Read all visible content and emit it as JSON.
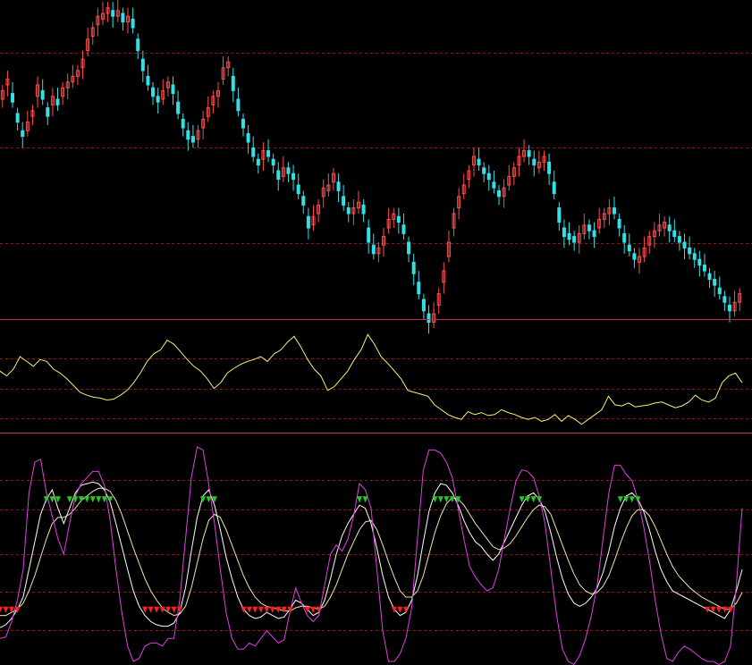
{
  "colors": {
    "background": "#000000",
    "grid": "#8b1a1a",
    "separator": "#c0304a",
    "up_candle": "#ff4d4d",
    "down_candle": "#33e0e6",
    "osc_line": "#f5f07a",
    "kdj_k": "#ffffff",
    "kdj_d": "#f0e6a8",
    "kdj_j": "#e040e0",
    "buy_marker": "#22cc22",
    "sell_marker": "#ff2020"
  },
  "chart_data": [
    {
      "type": "candlestick",
      "name": "price",
      "grid": true,
      "ylim": [
        0,
        100
      ],
      "close": [
        73,
        77,
        69,
        62,
        57,
        62,
        66,
        75,
        70,
        64,
        71,
        68,
        74,
        76,
        78,
        80,
        84,
        91,
        95,
        99,
        100,
        102,
        99,
        101,
        97,
        99,
        95,
        87,
        80,
        75,
        71,
        69,
        73,
        76,
        72,
        65,
        60,
        56,
        55,
        59,
        63,
        67,
        71,
        73,
        81,
        83,
        73,
        66,
        60,
        55,
        50,
        47,
        52,
        50,
        47,
        42,
        46,
        44,
        42,
        37,
        33,
        25,
        29,
        33,
        39,
        40,
        44,
        38,
        33,
        30,
        32,
        34,
        30,
        20,
        16,
        18,
        22,
        28,
        30,
        27,
        23,
        16,
        9,
        2,
        -4,
        -8,
        -5,
        2,
        10,
        20,
        30,
        36,
        40,
        45,
        50,
        47,
        44,
        42,
        39,
        36,
        39,
        43,
        46,
        50,
        52,
        50,
        47,
        48,
        50,
        44,
        37,
        27,
        22,
        21,
        20,
        23,
        26,
        24,
        22,
        28,
        30,
        32,
        30,
        25,
        20,
        17,
        14,
        15,
        18,
        22,
        24,
        26,
        27,
        24,
        22,
        20,
        18,
        16,
        14,
        12,
        10,
        7,
        5,
        2,
        -1,
        -4,
        -1,
        2
      ],
      "open_offsets": [
        -3,
        -2,
        3,
        3,
        2,
        -3,
        -2,
        -4,
        3,
        3,
        -3,
        2,
        -3,
        -2,
        -2,
        -2,
        -3,
        -4,
        -3,
        -3,
        -2,
        -2,
        2,
        -2,
        3,
        -2,
        3,
        4,
        4,
        3,
        3,
        2,
        -3,
        -2,
        3,
        4,
        3,
        3,
        2,
        -3,
        -3,
        -3,
        -3,
        -2,
        -4,
        -2,
        5,
        4,
        3,
        3,
        3,
        2,
        -3,
        2,
        2,
        3,
        -3,
        2,
        2,
        3,
        3,
        4,
        -3,
        -3,
        -3,
        -2,
        -3,
        3,
        3,
        2,
        -2,
        -2,
        3,
        5,
        3,
        -2,
        -3,
        -3,
        -2,
        2,
        3,
        4,
        4,
        4,
        4,
        3,
        -3,
        -4,
        -4,
        -5,
        -5,
        -4,
        -3,
        -3,
        -3,
        2,
        2,
        2,
        2,
        2,
        -3,
        -3,
        -3,
        -3,
        -2,
        2,
        2,
        -2,
        -2,
        4,
        4,
        5,
        3,
        2,
        2,
        -3,
        -3,
        2,
        2,
        -3,
        -2,
        -2,
        2,
        3,
        3,
        2,
        2,
        -2,
        -3,
        -3,
        -2,
        -2,
        -2,
        2,
        2,
        2,
        2,
        2,
        2,
        2,
        2,
        2,
        2,
        2,
        2,
        2,
        -3,
        -3
      ]
    },
    {
      "type": "line",
      "name": "oscillator",
      "grid": true,
      "ylim": [
        0,
        100
      ],
      "values": [
        60,
        55,
        62,
        75,
        70,
        65,
        72,
        70,
        62,
        58,
        52,
        45,
        38,
        35,
        33,
        32,
        30,
        31,
        35,
        40,
        48,
        58,
        70,
        78,
        82,
        92,
        88,
        80,
        72,
        65,
        60,
        52,
        42,
        48,
        58,
        63,
        67,
        70,
        72,
        75,
        70,
        78,
        82,
        90,
        96,
        85,
        72,
        62,
        55,
        40,
        44,
        52,
        60,
        72,
        82,
        98,
        88,
        75,
        68,
        60,
        52,
        40,
        38,
        36,
        34,
        25,
        20,
        15,
        12,
        10,
        18,
        15,
        17,
        14,
        15,
        20,
        17,
        15,
        12,
        10,
        12,
        8,
        10,
        15,
        8,
        14,
        10,
        5,
        10,
        15,
        20,
        34,
        25,
        24,
        27,
        23,
        24,
        25,
        27,
        28,
        25,
        22,
        24,
        28,
        35,
        30,
        28,
        32,
        48,
        55,
        58,
        48
      ]
    },
    {
      "type": "line",
      "name": "kdj",
      "grid": true,
      "ylim": [
        -20,
        120
      ],
      "series": [
        {
          "id": "k",
          "values": [
            2,
            4,
            8,
            14,
            22,
            40,
            58,
            76,
            86,
            92,
            80,
            70,
            80,
            90,
            95,
            96,
            97,
            96,
            92,
            84,
            70,
            55,
            40,
            26,
            16,
            10,
            6,
            4,
            3,
            3,
            5,
            12,
            28,
            52,
            74,
            88,
            92,
            82,
            66,
            48,
            34,
            22,
            14,
            10,
            8,
            9,
            12,
            10,
            8,
            9,
            14,
            20,
            18,
            14,
            10,
            12,
            20,
            34,
            50,
            62,
            70,
            76,
            82,
            80,
            70,
            54,
            36,
            22,
            14,
            10,
            12,
            20,
            36,
            58,
            78,
            90,
            96,
            95,
            90,
            82,
            72,
            64,
            58,
            55,
            50,
            46,
            50,
            58,
            66,
            74,
            82,
            88,
            90,
            86,
            78,
            64,
            48,
            34,
            24,
            18,
            16,
            18,
            22,
            28,
            38,
            52,
            68,
            80,
            88,
            90,
            86,
            78,
            66,
            52,
            40,
            32,
            26,
            24,
            22,
            20,
            18,
            16,
            14,
            12,
            10,
            8,
            14,
            26,
            40
          ]
        },
        {
          "id": "d",
          "values": [
            10,
            10,
            12,
            14,
            18,
            26,
            36,
            48,
            60,
            70,
            74,
            74,
            76,
            80,
            85,
            88,
            91,
            93,
            93,
            91,
            85,
            76,
            65,
            54,
            44,
            34,
            26,
            20,
            15,
            12,
            10,
            11,
            16,
            28,
            44,
            60,
            72,
            76,
            74,
            66,
            56,
            46,
            36,
            28,
            22,
            18,
            16,
            15,
            14,
            13,
            13,
            15,
            16,
            16,
            15,
            14,
            16,
            22,
            30,
            40,
            50,
            58,
            66,
            71,
            72,
            66,
            56,
            45,
            35,
            26,
            22,
            22,
            26,
            36,
            50,
            64,
            75,
            83,
            87,
            86,
            82,
            76,
            70,
            65,
            60,
            55,
            53,
            54,
            57,
            62,
            68,
            74,
            79,
            82,
            81,
            76,
            66,
            56,
            46,
            37,
            30,
            26,
            24,
            25,
            29,
            36,
            46,
            57,
            67,
            75,
            79,
            79,
            75,
            68,
            59,
            50,
            42,
            36,
            32,
            28,
            25,
            22,
            20,
            18,
            16,
            14,
            14,
            18,
            25
          ]
        },
        {
          "id": "j",
          "values": [
            -5,
            -4,
            6,
            20,
            40,
            90,
            110,
            112,
            90,
            75,
            60,
            50,
            70,
            88,
            96,
            100,
            104,
            104,
            95,
            72,
            40,
            12,
            -10,
            -20,
            -18,
            -10,
            -8,
            -8,
            -10,
            -5,
            -5,
            20,
            60,
            100,
            120,
            118,
            96,
            70,
            40,
            12,
            -5,
            -12,
            -12,
            -8,
            -10,
            -5,
            0,
            -4,
            -8,
            -6,
            12,
            28,
            18,
            10,
            6,
            10,
            30,
            50,
            56,
            52,
            60,
            75,
            96,
            92,
            80,
            40,
            0,
            -20,
            -20,
            -15,
            -5,
            15,
            60,
            105,
            118,
            118,
            116,
            110,
            100,
            80,
            60,
            42,
            35,
            30,
            26,
            28,
            40,
            60,
            80,
            98,
            105,
            104,
            100,
            88,
            70,
            40,
            10,
            -12,
            -20,
            -22,
            -16,
            -5,
            10,
            30,
            60,
            90,
            108,
            108,
            102,
            98,
            86,
            68,
            46,
            20,
            -2,
            -18,
            -20,
            -14,
            -10,
            -12,
            -15,
            -18,
            -20,
            -20,
            -22,
            -20,
            -10,
            30,
            80
          ]
        }
      ]
    }
  ]
}
